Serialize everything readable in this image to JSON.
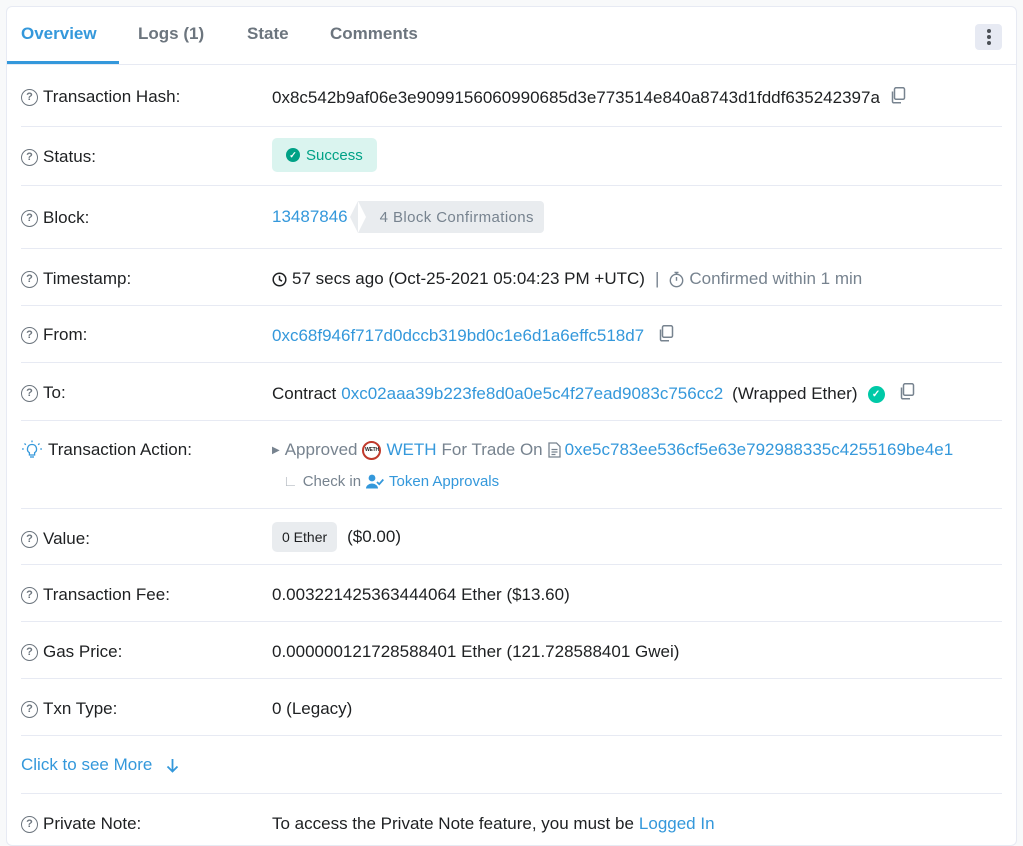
{
  "tabs": [
    {
      "label": "Overview"
    },
    {
      "label": "Logs (1)"
    },
    {
      "label": "State"
    },
    {
      "label": "Comments"
    }
  ],
  "rows": {
    "tx_hash": {
      "label": "Transaction Hash:",
      "value": "0x8c542b9af06e3e9099156060990685d3e773514e840a8743d1fddf635242397a"
    },
    "status": {
      "label": "Status:",
      "value": "Success"
    },
    "block": {
      "label": "Block:",
      "value": "13487846",
      "confirmations": "4 Block Confirmations"
    },
    "timestamp": {
      "label": "Timestamp:",
      "value": "57 secs ago (Oct-25-2021 05:04:23 PM +UTC)",
      "separator": "|",
      "confirmed": "Confirmed within 1 min"
    },
    "from": {
      "label": "From:",
      "value": "0xc68f946f717d0dccb319bd0c1e6d1a6effc518d7"
    },
    "to": {
      "label": "To:",
      "prefix": "Contract",
      "value": "0xc02aaa39b223fe8d0a0e5c4f27ead9083c756cc2",
      "name": "(Wrapped Ether)"
    },
    "action": {
      "label": "Transaction Action:",
      "approved": "Approved",
      "token_logo": "WETH",
      "token": "WETH",
      "for_trade": "For Trade On",
      "spender": "0xe5c783ee536cf5e63e792988335c4255169be4e1",
      "check_in": "Check in",
      "approvals_link": "Token Approvals"
    },
    "value": {
      "label": "Value:",
      "amount": "0 Ether",
      "usd": "($0.00)"
    },
    "fee": {
      "label": "Transaction Fee:",
      "value": "0.003221425363444064 Ether ($13.60)"
    },
    "gas_price": {
      "label": "Gas Price:",
      "value": "0.000000121728588401 Ether (121.728588401 Gwei)"
    },
    "txn_type": {
      "label": "Txn Type:",
      "value": "0 (Legacy)"
    },
    "private_note": {
      "label": "Private Note:",
      "text": "To access the Private Note feature, you must be",
      "link": "Logged In"
    }
  },
  "see_more": "Click to see More",
  "colors": {
    "accent": "#3498db",
    "success": "#00a186",
    "success_bg": "#daf4ef",
    "verified": "#00c9a7"
  }
}
